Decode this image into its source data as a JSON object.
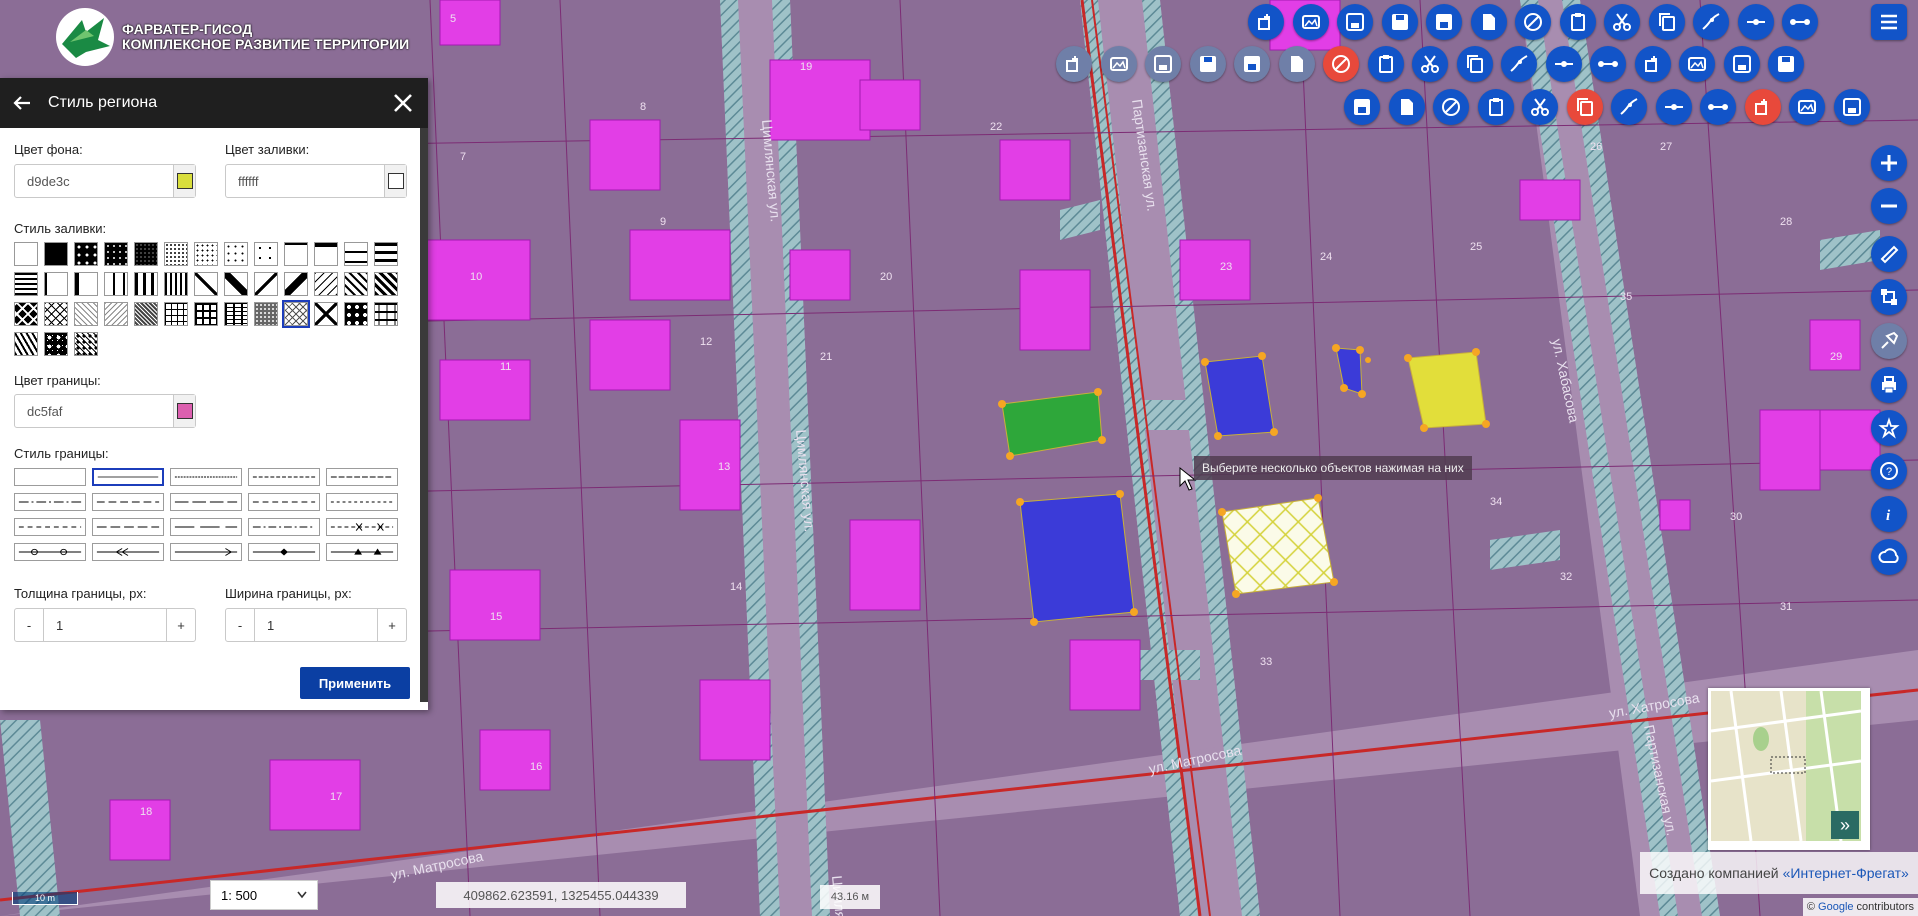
{
  "logo": {
    "line1": "ФАРВАТЕР-ГИСОД",
    "line2": "КОМПЛЕКСНОЕ РАЗВИТИЕ ТЕРРИТОРИИ"
  },
  "panel": {
    "title": "Стиль региона",
    "bg_color_label": "Цвет фона:",
    "bg_color_value": "d9de3c",
    "bg_color_hex": "#d9de3c",
    "fill_color_label": "Цвет заливки:",
    "fill_color_value": "ffffff",
    "fill_color_hex": "#ffffff",
    "fill_style_label": "Стиль заливки:",
    "fill_pattern_count": 42,
    "selected_fill_pattern": 35,
    "border_color_label": "Цвет границы:",
    "border_color_value": "dc5faf",
    "border_color_hex": "#dc5faf",
    "border_style_label": "Стиль границы:",
    "selected_border_style": 1,
    "border_thickness_label": "Толщина границы, px:",
    "border_thickness_value": "1",
    "border_width_label": "Ширина границы, px:",
    "border_width_value": "1",
    "minus": "-",
    "plus": "+",
    "apply_label": "Применить"
  },
  "streets": {
    "tsimlyanskaya_1": "Цимлянская ул.",
    "tsimlyanskaya_2": "Цимлянская ул.",
    "partizanskaya_1": "Партизанская ул.",
    "partizanskaya_2": "Партизанская ул.",
    "matrosova_1": "ул. Матросова",
    "matrosova_2": "ул. Матросова",
    "khatrosova": "ул. Хатросова",
    "khabasova": "ул. Хабасова",
    "tsim_bottom": "Цимлянская"
  },
  "house_numbers": [
    "5",
    "7",
    "8",
    "9",
    "10",
    "11",
    "12",
    "13",
    "14",
    "15",
    "16",
    "17",
    "18",
    "19",
    "20",
    "21",
    "22",
    "23",
    "24",
    "25",
    "26",
    "27",
    "28",
    "29",
    "30",
    "31",
    "32",
    "33",
    "34",
    "35"
  ],
  "tooltip": "Выберите несколько объектов нажимая на них",
  "scale_bar": "10 m",
  "scale_select": "1: 500",
  "coords": "409862.623591, 1325455.044339",
  "measure": "43.16 м",
  "credit": {
    "prefix": "Создано компанией",
    "link": "«Интернет-Фрегат»"
  },
  "attribution": {
    "prefix": "©",
    "google": "Google",
    "contributors": "contributors"
  },
  "colors": {
    "accent": "#1254c8",
    "red_tool": "#e8493b",
    "apply": "#0b3fa3",
    "pink_overlay": "#e040e0",
    "selection_handle": "#f5a623"
  },
  "toolbar_icons": [
    "add-layer-icon",
    "image-layer-icon",
    "save-as-icon",
    "save-icon",
    "save-disk-icon",
    "new-file-icon",
    "cancel-icon",
    "clipboard-icon",
    "scissors-icon",
    "copy-icon",
    "edit-line-icon",
    "vertex-icon",
    "segment-icon",
    "polyline-icon",
    "reshape-icon",
    "split-icon",
    "merge-icon",
    "union-icon",
    "duplicate-icon",
    "select-region-icon",
    "fill-bucket-icon",
    "magic-wand-icon",
    "text-icon",
    "rotate-icon",
    "move-icon",
    "transform-icon",
    "nodes-icon",
    "branch-icon",
    "resize-icon",
    "person-icon",
    "check-all-icon",
    "measure-tools-icon",
    "shapes-icon",
    "smooth-icon",
    "triangle-icon",
    "route-icon",
    "lasso-icon",
    "ruler-icon",
    "hatch-icon",
    "pencil-icon",
    "settings-icon",
    "close-editor-icon"
  ],
  "right_tools": [
    "zoom-in-icon",
    "zoom-out-icon",
    "ruler-measure-icon",
    "network-icon",
    "clean-icon",
    "print-icon",
    "favorite-icon",
    "help-icon",
    "info-icon",
    "cloud-icon"
  ],
  "minimap_expand": "»"
}
